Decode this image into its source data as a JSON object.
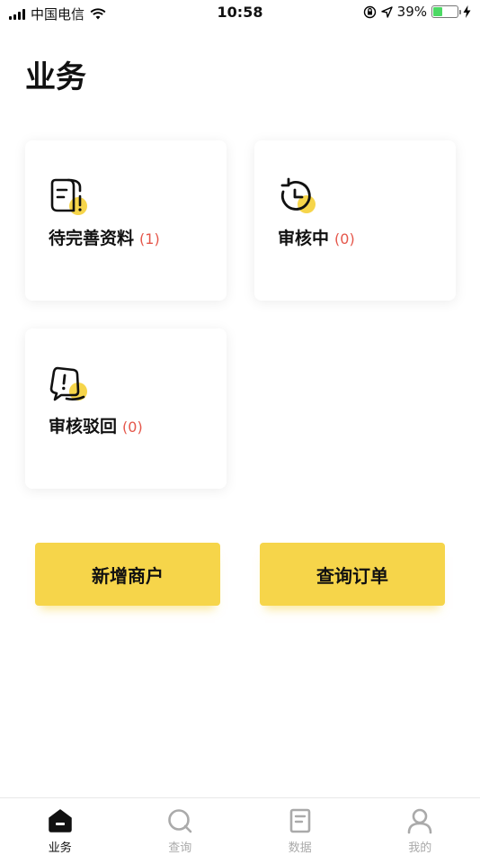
{
  "status_bar": {
    "carrier": "中国电信",
    "time": "10:58",
    "battery": "39%",
    "battery_level": 0.39
  },
  "page": {
    "title": "业务"
  },
  "cards": [
    {
      "label": "待完善资料",
      "count": "(1)",
      "icon": "document-icon"
    },
    {
      "label": "审核中",
      "count": "(0)",
      "icon": "clock-refresh-icon"
    },
    {
      "label": "审核驳回",
      "count": "(0)",
      "icon": "rejected-icon"
    }
  ],
  "actions": {
    "add_merchant": "新增商户",
    "query_orders": "查询订单"
  },
  "colors": {
    "accent": "#f6d54a",
    "count_red": "#e5574b",
    "tab_inactive": "#aaaaaa"
  },
  "tabs": [
    {
      "label": "业务",
      "icon": "business-icon",
      "active": true
    },
    {
      "label": "查询",
      "icon": "search-icon",
      "active": false
    },
    {
      "label": "数据",
      "icon": "data-icon",
      "active": false
    },
    {
      "label": "我的",
      "icon": "user-icon",
      "active": false
    }
  ]
}
